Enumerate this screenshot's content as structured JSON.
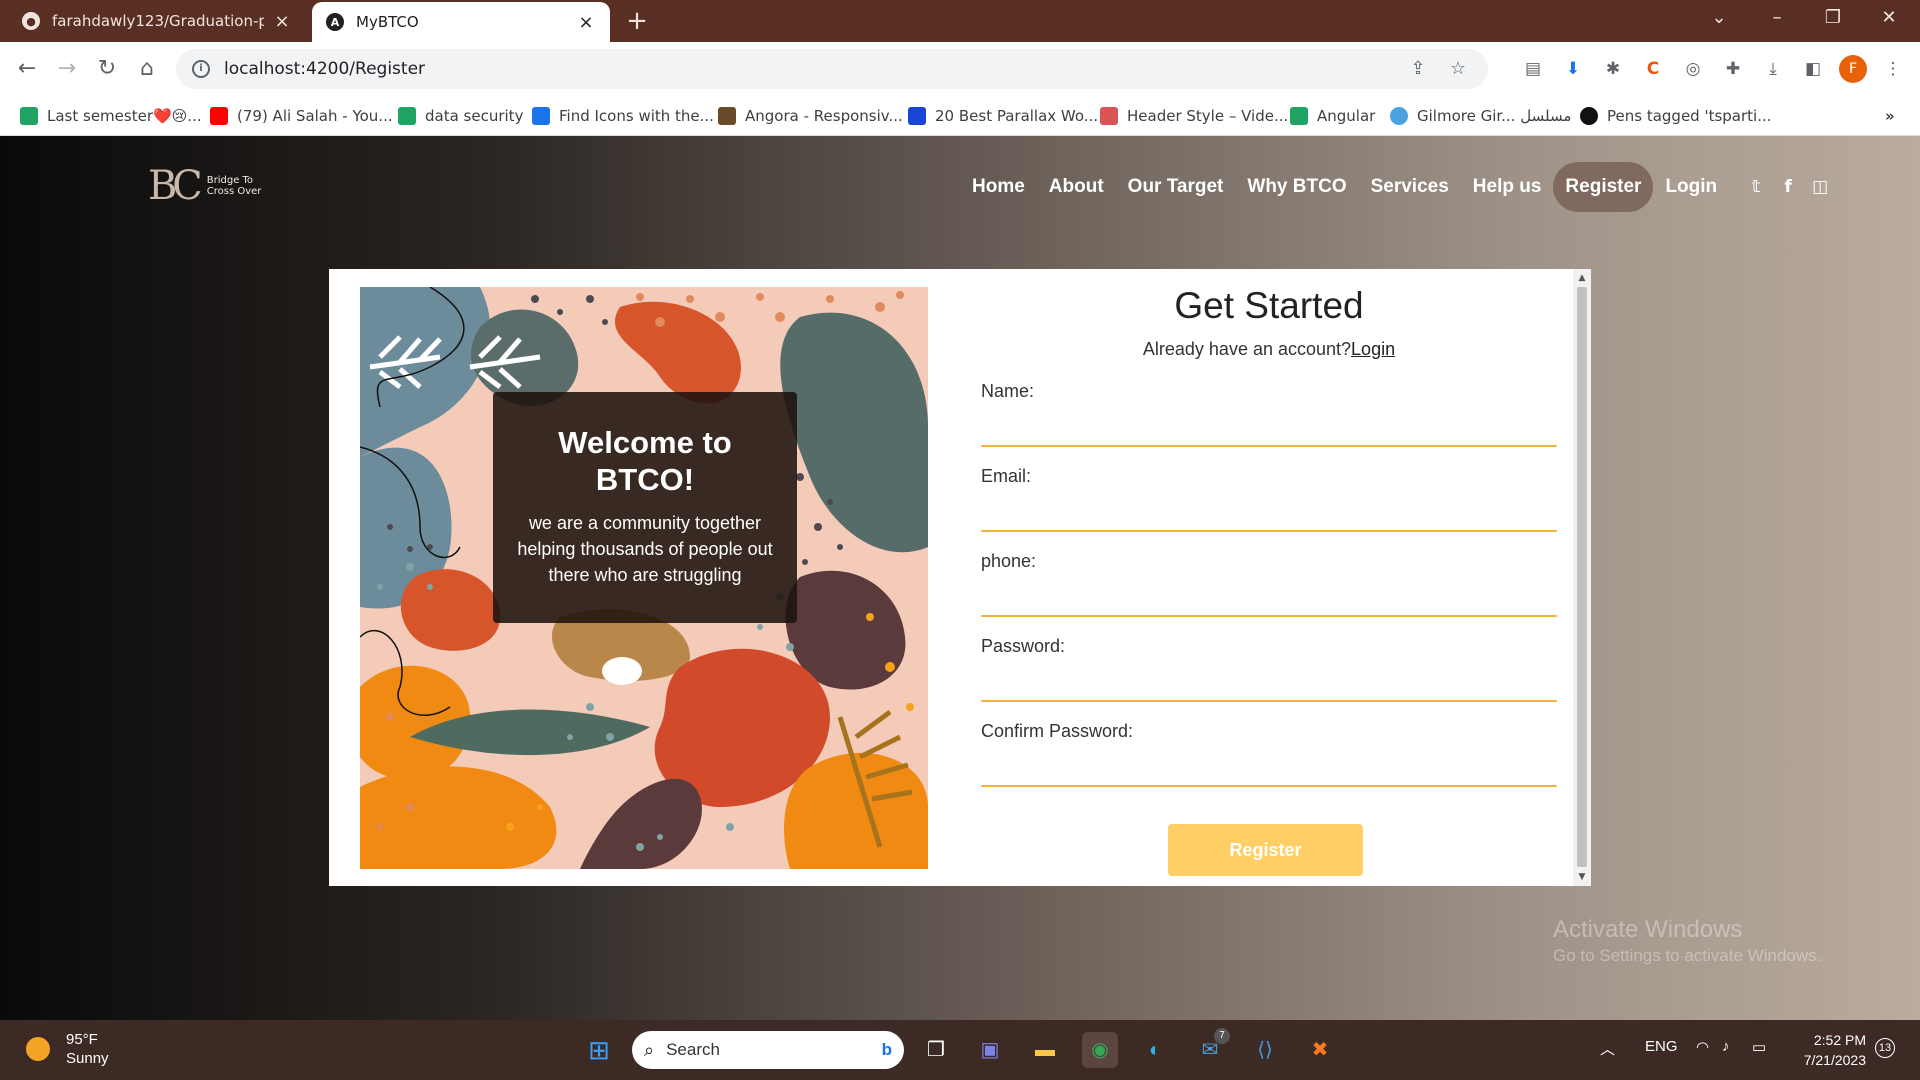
{
  "browser": {
    "tabs": [
      {
        "title": "farahdawly123/Graduation-proje",
        "icon": "github-icon"
      },
      {
        "title": "MyBTCO",
        "icon": "angular-icon"
      }
    ],
    "url": "localhost:4200/Register",
    "bookmarks": [
      {
        "label": "Last semester❤️😢...",
        "icon": "google-drive-icon",
        "color": "#1fa463"
      },
      {
        "label": "(79) Ali Salah - You...",
        "icon": "youtube-icon",
        "color": "#ff0000"
      },
      {
        "label": "data security",
        "icon": "google-drive-icon",
        "color": "#1fa463"
      },
      {
        "label": "Find Icons with the...",
        "icon": "flag-icon",
        "color": "#1a73e8"
      },
      {
        "label": "Angora - Responsiv...",
        "icon": "site-icon",
        "color": "#6b4a2b"
      },
      {
        "label": "20 Best Parallax Wo...",
        "icon": "stairs-icon",
        "color": "#1a46d6"
      },
      {
        "label": "Header Style – Vide...",
        "icon": "triangle-icon",
        "color": "#d95454"
      },
      {
        "label": "Angular",
        "icon": "google-drive-icon",
        "color": "#1fa463"
      },
      {
        "label": "Gilmore Gir... مسلسل",
        "icon": "globe-icon",
        "color": "#4aa3df"
      },
      {
        "label": "Pens tagged 'tsparti...",
        "icon": "codepen-icon",
        "color": "#111111"
      }
    ]
  },
  "site": {
    "logo_mark": "BC",
    "logo_line1": "Bridge To",
    "logo_line2": "Cross Over",
    "nav": [
      "Home",
      "About",
      "Our Target",
      "Why BTCO",
      "Services",
      "Help us",
      "Register",
      "Login"
    ],
    "social": [
      "twitter-icon",
      "facebook-icon",
      "instagram-icon"
    ]
  },
  "welcome": {
    "title": "Welcome to BTCO!",
    "text": "we are a community together helping thousands of people out there who are struggling"
  },
  "form": {
    "title": "Get Started",
    "already": "Already have an account?",
    "login_link": "Login",
    "fields": [
      "Name:",
      "Email:",
      "phone:",
      "Password:",
      "Confirm Password:"
    ],
    "submit": "Register"
  },
  "watermark": {
    "line1": "Activate Windows",
    "line2": "Go to Settings to activate Windows."
  },
  "taskbar": {
    "temp": "95°F",
    "condition": "Sunny",
    "search_placeholder": "Search",
    "lang": "ENG",
    "time": "2:52 PM",
    "date": "7/21/2023",
    "notifications": "13",
    "mail_badge": "7"
  },
  "colors": {
    "accent": "#f0b43c",
    "button": "#ffcf66",
    "nav_active": "#806a5f"
  }
}
